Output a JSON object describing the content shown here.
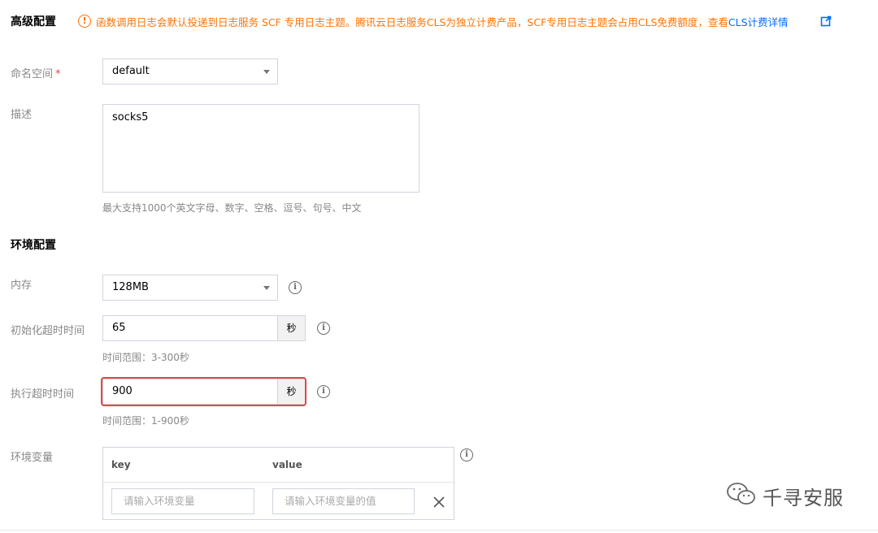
{
  "advanced": {
    "title": "高级配置",
    "notice_text": "函数调用日志会默认投递到日志服务 SCF 专用日志主题。腾讯云日志服务CLS为独立计费产品，SCF专用日志主题会占用CLS免费额度，查看",
    "notice_link": "CLS计费详情"
  },
  "namespace": {
    "label": "命名空间",
    "required_mark": "*",
    "value": "default"
  },
  "description": {
    "label": "描述",
    "value": "socks5",
    "hint": "最大支持1000个英文字母、数字、空格、逗号、句号、中文"
  },
  "environment": {
    "title": "环境配置",
    "memory": {
      "label": "内存",
      "value": "128MB"
    },
    "init_timeout": {
      "label": "初始化超时时间",
      "value": "65",
      "unit": "秒",
      "hint": "时间范围：3-300秒"
    },
    "exec_timeout": {
      "label": "执行超时时间",
      "value": "900",
      "unit": "秒",
      "hint": "时间范围：1-900秒"
    },
    "env_vars": {
      "label": "环境变量",
      "key_header": "key",
      "value_header": "value",
      "key_placeholder": "请输入环境变量",
      "value_placeholder": "请输入环境变量的值"
    }
  },
  "watermark": "千寻安服",
  "colors": {
    "warning": "#ff7200",
    "link": "#006eff",
    "highlight": "#e54545"
  }
}
